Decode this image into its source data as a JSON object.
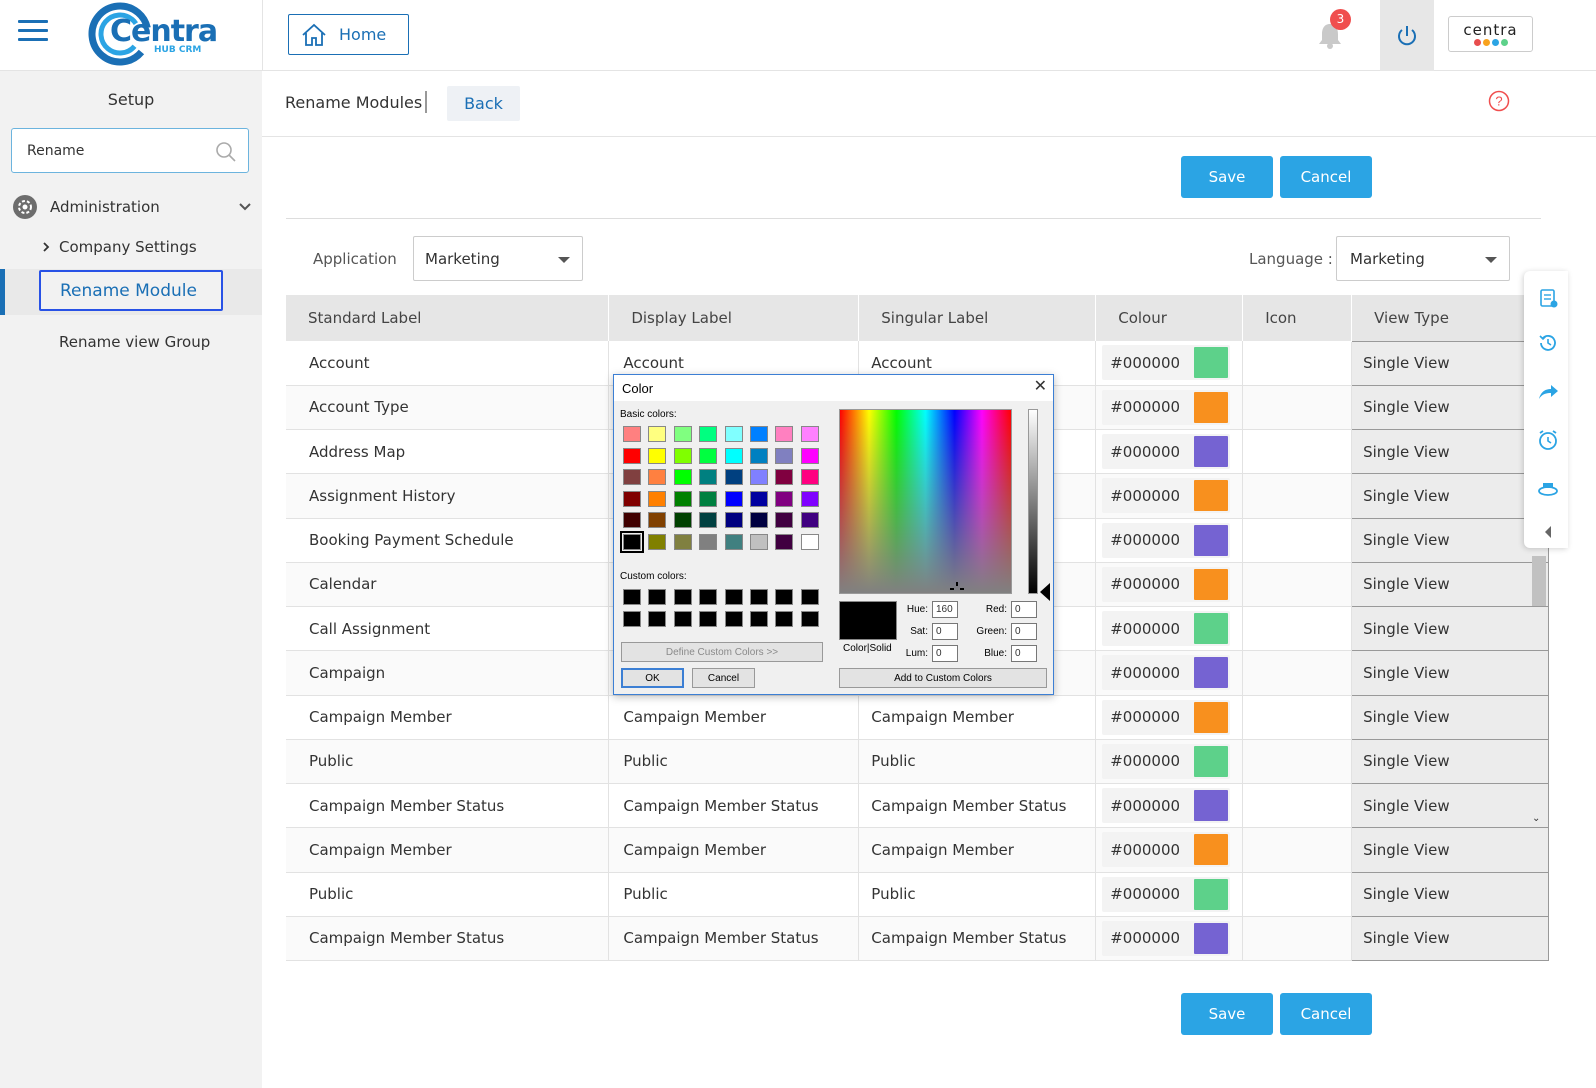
{
  "header": {
    "logo_text": "Centra",
    "logo_sub": "HUB CRM",
    "home_label": "Home",
    "notification_count": "3",
    "brand_text": "centra"
  },
  "sidebar": {
    "title": "Setup",
    "search_value": "Rename",
    "admin_label": "Administration",
    "company_settings_label": "Company Settings",
    "rename_module_label": "Rename Module",
    "rename_view_group_label": "Rename view Group"
  },
  "main": {
    "page_title": "Rename Modules",
    "back_label": "Back",
    "save_label": "Save",
    "cancel_label": "Cancel",
    "application_label": "Application",
    "application_value": "Marketing",
    "language_label": "Language :",
    "language_value": "Marketing"
  },
  "table": {
    "headers": [
      "Standard Label",
      "Display Label",
      "Singular Label",
      "Colour",
      "Icon",
      "View Type"
    ],
    "rows": [
      {
        "standard": "Account",
        "display": "Account",
        "singular": "Account",
        "hex": "#000000",
        "swatch": "#5dd18a",
        "view": "Single View"
      },
      {
        "standard": "Account Type",
        "display": "",
        "singular": "",
        "hex": "#000000",
        "swatch": "#f8901e",
        "view": "Single View"
      },
      {
        "standard": "Address Map",
        "display": "",
        "singular": "",
        "hex": "#000000",
        "swatch": "#7563d2",
        "view": "Single View"
      },
      {
        "standard": "Assignment History",
        "display": "",
        "singular": "",
        "hex": "#000000",
        "swatch": "#f8901e",
        "view": "Single View"
      },
      {
        "standard": "Booking Payment Schedule",
        "display": "",
        "singular": "",
        "hex": "#000000",
        "swatch": "#7563d2",
        "view": "Single View"
      },
      {
        "standard": "Calendar",
        "display": "",
        "singular": "",
        "hex": "#000000",
        "swatch": "#f8901e",
        "view": "Single View"
      },
      {
        "standard": "Call Assignment",
        "display": "",
        "singular": "",
        "hex": "#000000",
        "swatch": "#5dd18a",
        "view": "Single View"
      },
      {
        "standard": "Campaign",
        "display": "",
        "singular": "",
        "hex": "#000000",
        "swatch": "#7563d2",
        "view": "Single View"
      },
      {
        "standard": "Campaign Member",
        "display": "Campaign Member",
        "singular": "Campaign Member",
        "hex": "#000000",
        "swatch": "#f8901e",
        "view": "Single View"
      },
      {
        "standard": "Public",
        "display": "Public",
        "singular": "Public",
        "hex": "#000000",
        "swatch": "#5dd18a",
        "view": "Single View"
      },
      {
        "standard": "Campaign Member Status",
        "display": "Campaign Member Status",
        "singular": "Campaign Member Status",
        "hex": "#000000",
        "swatch": "#7563d2",
        "view": "Single View"
      },
      {
        "standard": "Campaign Member",
        "display": "Campaign Member",
        "singular": "Campaign Member",
        "hex": "#000000",
        "swatch": "#f8901e",
        "view": "Single View"
      },
      {
        "standard": "Public",
        "display": "Public",
        "singular": "Public",
        "hex": "#000000",
        "swatch": "#5dd18a",
        "view": "Single View"
      },
      {
        "standard": "Campaign Member Status",
        "display": "Campaign Member Status",
        "singular": "Campaign Member Status",
        "hex": "#000000",
        "swatch": "#7563d2",
        "view": "Single View"
      }
    ]
  },
  "color_dialog": {
    "title": "Color",
    "basic_colors_label": "Basic colors:",
    "custom_colors_label": "Custom colors:",
    "define_custom_label": "Define Custom Colors >>",
    "ok_label": "OK",
    "cancel_label": "Cancel",
    "add_custom_label": "Add to Custom Colors",
    "color_solid_label": "Color|Solid",
    "hue_label": "Hue:",
    "hue_value": "160",
    "sat_label": "Sat:",
    "sat_value": "0",
    "lum_label": "Lum:",
    "lum_value": "0",
    "red_label": "Red:",
    "red_value": "0",
    "green_label": "Green:",
    "green_value": "0",
    "blue_label": "Blue:",
    "blue_value": "0",
    "basic_colors": [
      "#ff8080",
      "#ffff80",
      "#80ff80",
      "#00ff80",
      "#80ffff",
      "#0080ff",
      "#ff80c0",
      "#ff80ff",
      "#ff0000",
      "#ffff00",
      "#80ff00",
      "#00ff40",
      "#00ffff",
      "#0080c0",
      "#8080c0",
      "#ff00ff",
      "#804040",
      "#ff8040",
      "#00ff00",
      "#008080",
      "#004080",
      "#8080ff",
      "#800040",
      "#ff0080",
      "#800000",
      "#ff8000",
      "#008000",
      "#008040",
      "#0000ff",
      "#0000a0",
      "#800080",
      "#8000ff",
      "#400000",
      "#804000",
      "#004000",
      "#004040",
      "#000080",
      "#000040",
      "#400040",
      "#400080",
      "#000000",
      "#808000",
      "#808040",
      "#808080",
      "#408080",
      "#c0c0c0",
      "#400040",
      "#ffffff"
    ],
    "selected_basic_index": 40
  },
  "colors": {
    "accent": "#1a6fb5",
    "button": "#2ba4e4",
    "badge": "#f04e4e"
  }
}
